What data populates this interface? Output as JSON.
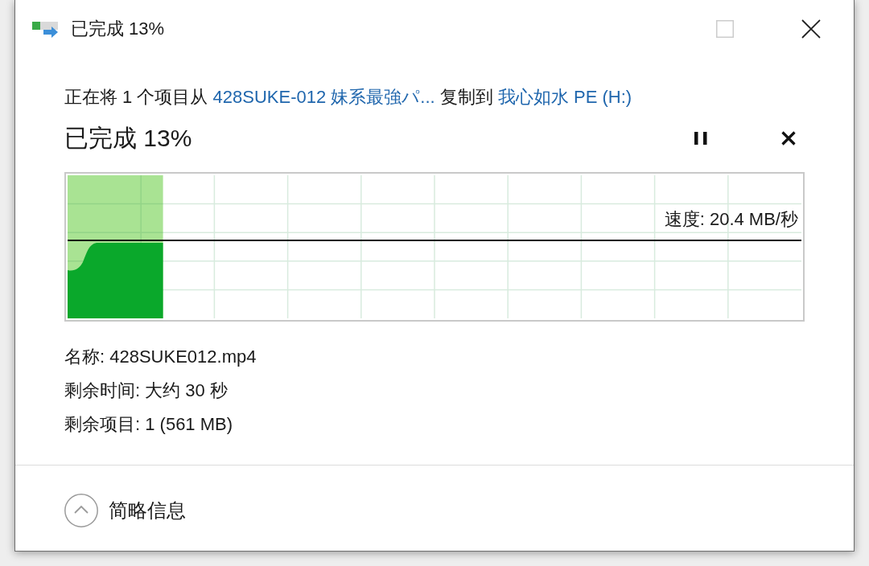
{
  "title_bar": {
    "title": "已完成 13%",
    "maximize_disabled": true
  },
  "copy_line": [
    {
      "kind": "text",
      "text": "正在将 1 个项目从"
    },
    {
      "kind": "link",
      "text": "428SUKE-012 妹系最強パ..."
    },
    {
      "kind": "text",
      "text": "复制到"
    },
    {
      "kind": "link",
      "text": "我心如水 PE (H:)"
    }
  ],
  "progress": {
    "heading": "已完成 13%",
    "level": 0.13,
    "speed": "速度: 20.4 MB/秒"
  },
  "details": [
    "名称: 428SUKE012.mp4",
    "剩余时间: 大约 30 秒",
    "剩余项目: 1 (561 MB)"
  ],
  "details_toggle": {
    "label": "简略信息",
    "expanded": true
  }
}
